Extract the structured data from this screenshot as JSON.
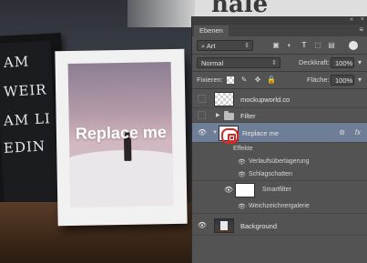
{
  "photo": {
    "handwriting": [
      "AM",
      "WEIR",
      "AM LI",
      "EDIN"
    ],
    "replace_text": "Replace me"
  },
  "decor": {
    "text": "hale"
  },
  "panel": {
    "collapse_icon": "«",
    "close_icon": "×",
    "tab_label": "Ebenen",
    "menu_icon": "≡",
    "filter": {
      "kind_label": "Art",
      "icons": [
        "image-icon",
        "adjustment-icon",
        "type-icon",
        "shape-icon",
        "smartobject-icon"
      ]
    },
    "blend": {
      "mode": "Normal",
      "opacity_label": "Deckkraft:",
      "opacity_value": "100%"
    },
    "lock": {
      "label": "Fixieren:",
      "fill_label": "Fläche:",
      "fill_value": "100%"
    },
    "layers": [
      {
        "name": "mockupworld.co",
        "visible": false,
        "type": "layer"
      },
      {
        "name": "Filter",
        "visible": false,
        "type": "group"
      },
      {
        "name": "Replace me",
        "visible": true,
        "type": "smartobject",
        "selected": true,
        "fx": "fx"
      },
      {
        "name": "Effekte",
        "type": "effects-header"
      },
      {
        "name": "Verlaufsüberlagerung",
        "type": "effect"
      },
      {
        "name": "Schlagschatten",
        "type": "effect"
      },
      {
        "name": "Smartfilter",
        "type": "smartfilter"
      },
      {
        "name": "Weichzeichnergalerie",
        "type": "filter"
      },
      {
        "name": "Background",
        "visible": true,
        "type": "background"
      }
    ]
  },
  "colors": {
    "panel_bg": "#535353",
    "selected_row": "#6e7e96",
    "highlight_mark": "#d22a2a"
  }
}
